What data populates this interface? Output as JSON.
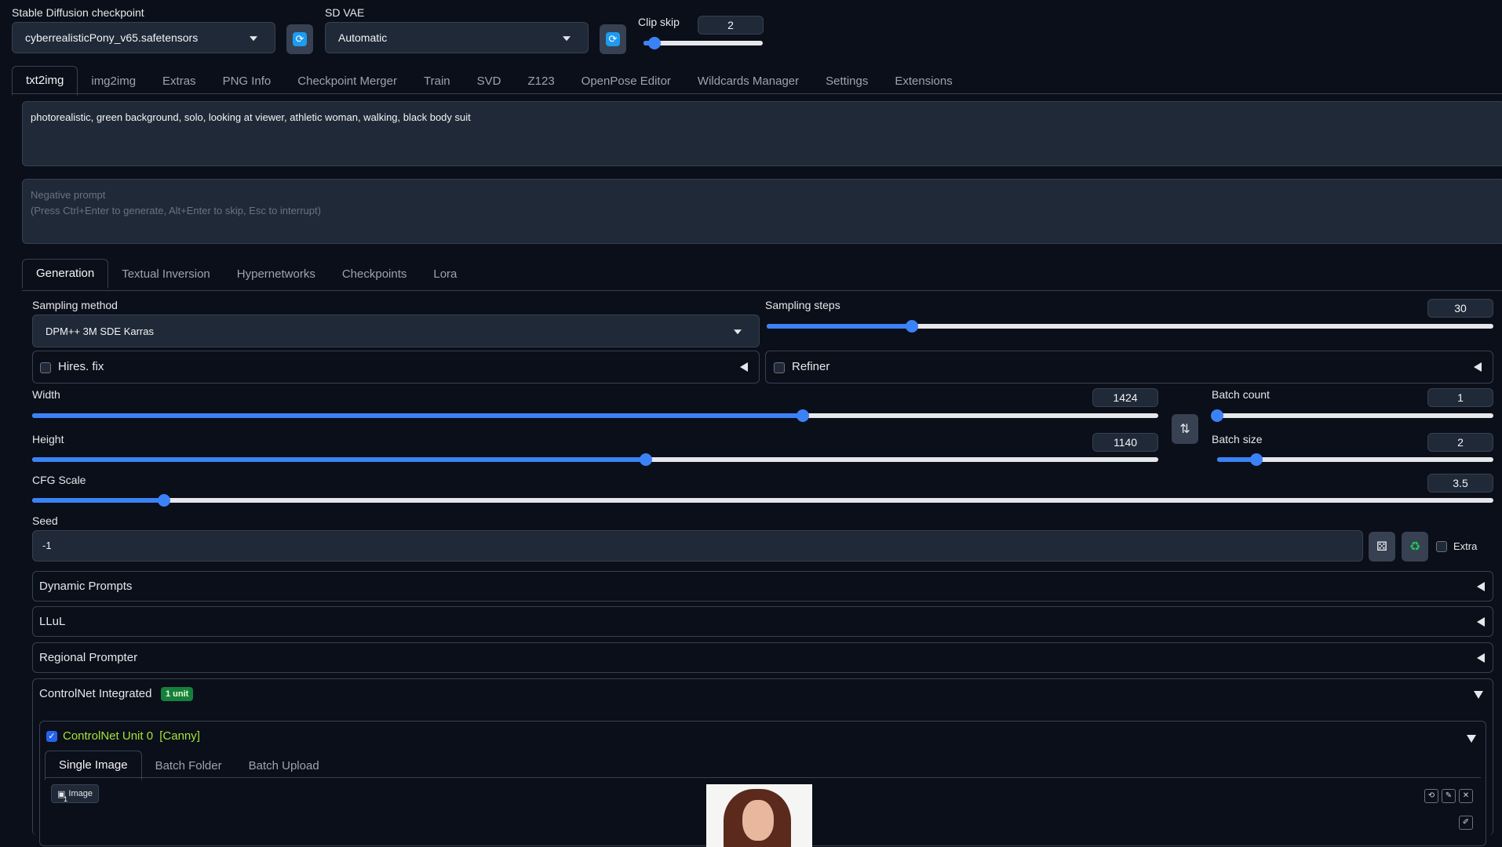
{
  "header": {
    "checkpoint_label": "Stable Diffusion checkpoint",
    "checkpoint_value": "cyberrealisticPony_v65.safetensors",
    "vae_label": "SD VAE",
    "vae_value": "Automatic",
    "clip_skip_label": "Clip skip",
    "clip_skip_value": "2",
    "clip_skip_min": 1,
    "clip_skip_max": 12
  },
  "main_tabs": [
    "txt2img",
    "img2img",
    "Extras",
    "PNG Info",
    "Checkpoint Merger",
    "Train",
    "SVD",
    "Z123",
    "OpenPose Editor",
    "Wildcards Manager",
    "Settings",
    "Extensions"
  ],
  "prompt": {
    "text": "photorealistic, green background, solo, looking at viewer, athletic woman, walking, black body suit",
    "negative_placeholder_line1": "Negative prompt",
    "negative_placeholder_line2": "(Press Ctrl+Enter to generate, Alt+Enter to skip, Esc to interrupt)"
  },
  "sub_tabs": [
    "Generation",
    "Textual Inversion",
    "Hypernetworks",
    "Checkpoints",
    "Lora"
  ],
  "generation": {
    "sampling_method_label": "Sampling method",
    "sampling_method_value": "DPM++ 3M SDE Karras",
    "sampling_steps_label": "Sampling steps",
    "sampling_steps_value": "30",
    "sampling_steps_fraction": 0.2,
    "hires_label": "Hires. fix",
    "refiner_label": "Refiner",
    "width_label": "Width",
    "width_value": "1424",
    "width_fraction": 0.684,
    "height_label": "Height",
    "height_value": "1140",
    "height_fraction": 0.545,
    "batch_count_label": "Batch count",
    "batch_count_value": "1",
    "batch_count_fraction": 0.0,
    "batch_size_label": "Batch size",
    "batch_size_value": "2",
    "batch_size_fraction": 0.143,
    "cfg_label": "CFG Scale",
    "cfg_value": "3.5",
    "cfg_fraction": 0.09,
    "seed_label": "Seed",
    "seed_value": "-1",
    "extra_label": "Extra"
  },
  "accordions": {
    "dynamic_prompts": "Dynamic Prompts",
    "llul": "LLuL",
    "regional_prompter": "Regional Prompter",
    "controlnet": "ControlNet Integrated",
    "controlnet_badge": "1 unit"
  },
  "controlnet_unit": {
    "title": "ControlNet Unit 0",
    "model_tag": "[Canny]",
    "tabs": [
      "Single Image",
      "Batch Folder",
      "Batch Upload"
    ],
    "image_label": "Image",
    "image_badge": "1"
  },
  "colors": {
    "accent": "#3b82f6",
    "background": "#0b0f19",
    "controlnet_title": "#a3e635",
    "badge_bg": "#15803d"
  }
}
